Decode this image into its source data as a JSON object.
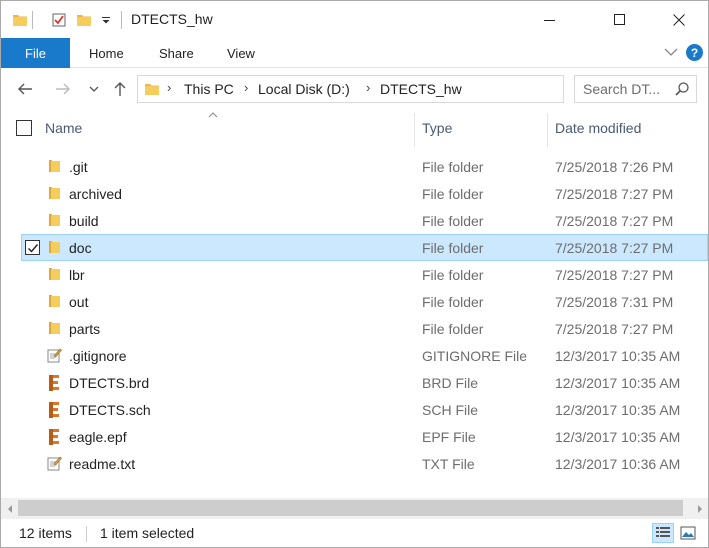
{
  "window": {
    "title": "DTECTS_hw"
  },
  "ribbon": {
    "tabs": [
      "File",
      "Home",
      "Share",
      "View"
    ],
    "help_label": "?"
  },
  "address": {
    "crumbs": [
      "This PC",
      "Local Disk (D:)",
      "DTECTS_hw"
    ]
  },
  "search": {
    "placeholder": "Search DT..."
  },
  "columns": {
    "name": "Name",
    "type": "Type",
    "date": "Date modified"
  },
  "files": [
    {
      "name": ".git",
      "type": "File folder",
      "date": "7/25/2018 7:26 PM",
      "icon": "folder-icon",
      "selected": false
    },
    {
      "name": "archived",
      "type": "File folder",
      "date": "7/25/2018 7:27 PM",
      "icon": "folder-icon",
      "selected": false
    },
    {
      "name": "build",
      "type": "File folder",
      "date": "7/25/2018 7:27 PM",
      "icon": "folder-icon",
      "selected": false
    },
    {
      "name": "doc",
      "type": "File folder",
      "date": "7/25/2018 7:27 PM",
      "icon": "folder-icon",
      "selected": true
    },
    {
      "name": "lbr",
      "type": "File folder",
      "date": "7/25/2018 7:27 PM",
      "icon": "folder-icon",
      "selected": false
    },
    {
      "name": "out",
      "type": "File folder",
      "date": "7/25/2018 7:31 PM",
      "icon": "folder-icon",
      "selected": false
    },
    {
      "name": "parts",
      "type": "File folder",
      "date": "7/25/2018 7:27 PM",
      "icon": "folder-icon",
      "selected": false
    },
    {
      "name": ".gitignore",
      "type": "GITIGNORE File",
      "date": "12/3/2017 10:35 AM",
      "icon": "text-file-icon",
      "selected": false
    },
    {
      "name": "DTECTS.brd",
      "type": "BRD File",
      "date": "12/3/2017 10:35 AM",
      "icon": "eagle-file-icon",
      "selected": false
    },
    {
      "name": "DTECTS.sch",
      "type": "SCH File",
      "date": "12/3/2017 10:35 AM",
      "icon": "eagle-file-icon",
      "selected": false
    },
    {
      "name": "eagle.epf",
      "type": "EPF File",
      "date": "12/3/2017 10:35 AM",
      "icon": "eagle-file-icon",
      "selected": false
    },
    {
      "name": "readme.txt",
      "type": "TXT File",
      "date": "12/3/2017 10:36 AM",
      "icon": "text-file-icon",
      "selected": false
    }
  ],
  "status": {
    "item_count": "12 items",
    "selection": "1 item selected"
  },
  "colors": {
    "accent": "#1979ca",
    "selection_bg": "#cce8ff",
    "selection_border": "#99d1ff",
    "folder": "#e8b84a"
  }
}
